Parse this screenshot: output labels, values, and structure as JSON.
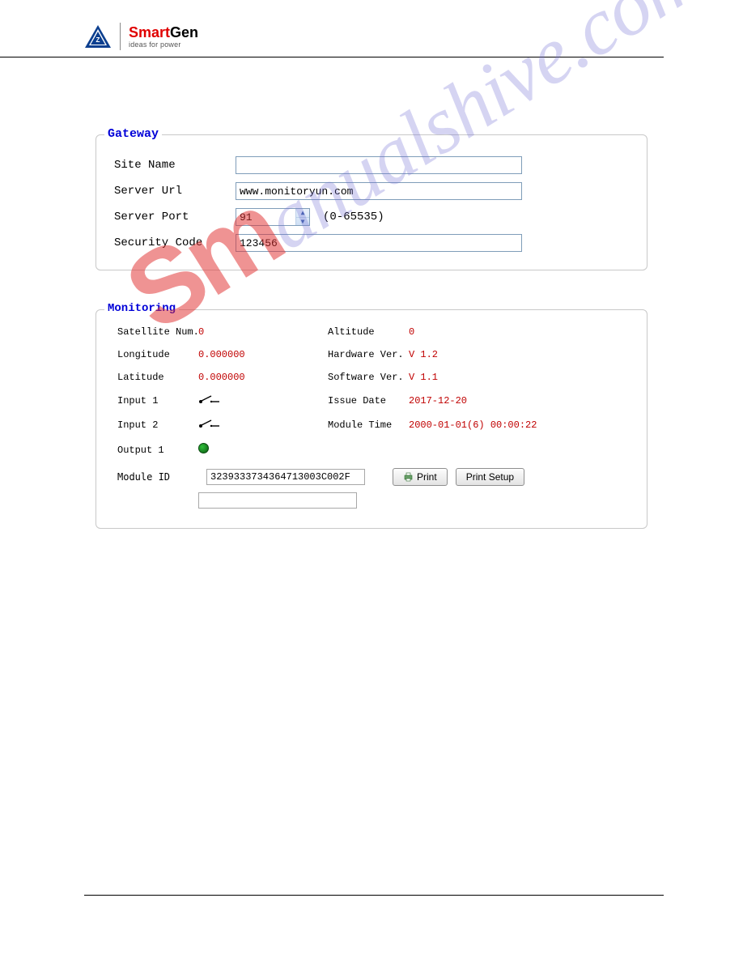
{
  "header": {
    "brand_prefix": "Smart",
    "brand_suffix": "Gen",
    "tagline": "ideas for power"
  },
  "gateway": {
    "legend": "Gateway",
    "site_name_label": "Site Name",
    "site_name_value": "",
    "server_url_label": "Server Url",
    "server_url_value": "www.monitoryun.com",
    "server_port_label": "Server Port",
    "server_port_value": "91",
    "server_port_hint": "(0-65535)",
    "security_code_label": "Security Code",
    "security_code_value": "123456"
  },
  "monitoring": {
    "legend": "Monitoring",
    "satellite_num_label": "Satellite Num.",
    "satellite_num_value": "0",
    "longitude_label": "Longitude",
    "longitude_value": "0.000000",
    "latitude_label": "Latitude",
    "latitude_value": "0.000000",
    "input1_label": "Input 1",
    "input2_label": "Input 2",
    "output1_label": "Output 1",
    "altitude_label": "Altitude",
    "altitude_value": "0",
    "hw_label": "Hardware Ver.",
    "hw_value": "V 1.2",
    "sw_label": "Software Ver.",
    "sw_value": "V 1.1",
    "issue_date_label": "Issue Date",
    "issue_date_value": "2017-12-20",
    "module_time_label": "Module Time",
    "module_time_value": "2000-01-01(6) 00:00:22",
    "module_id_label": "Module ID",
    "module_id_value": "3239333734364713003C002F",
    "print_label": "Print",
    "print_setup_label": "Print Setup",
    "extra_value": ""
  },
  "watermark": {
    "part1": "Sm",
    "part2": "anualshive.com"
  }
}
